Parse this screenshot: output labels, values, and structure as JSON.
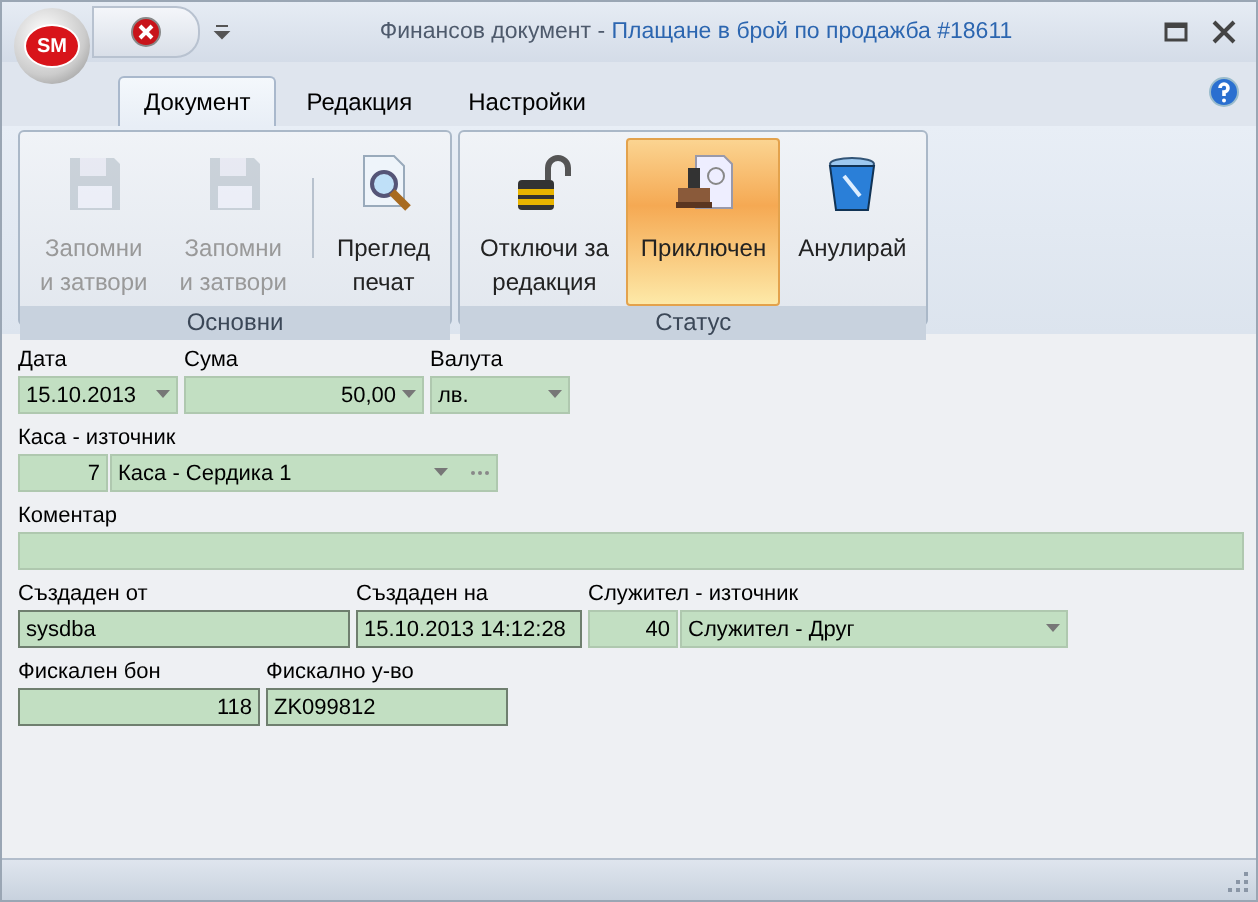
{
  "window": {
    "app_badge": "SM",
    "title_prefix": "Финансов документ - ",
    "title_main": "Плащане в брой по продажба #18611"
  },
  "tabs": [
    {
      "label": "Документ",
      "selected": true
    },
    {
      "label": "Редакция",
      "selected": false
    },
    {
      "label": "Настройки",
      "selected": false
    }
  ],
  "ribbon_groups": [
    {
      "label": "Основни",
      "buttons": [
        {
          "kind": "floppy",
          "label": "Запомни\nи затвори",
          "disabled": true,
          "selected": false,
          "separator_before": false
        },
        {
          "kind": "floppy",
          "label": "Запомни\nи затвори",
          "disabled": true,
          "selected": false,
          "separator_before": false
        },
        {
          "kind": "preview",
          "label": "Преглед\nпечат",
          "disabled": false,
          "selected": false,
          "separator_before": true
        }
      ]
    },
    {
      "label": "Статус",
      "buttons": [
        {
          "kind": "padlock",
          "label": "Отключи за\nредакция",
          "disabled": false,
          "selected": false,
          "separator_before": false
        },
        {
          "kind": "stamp",
          "label": "Приключен",
          "disabled": false,
          "selected": true,
          "separator_before": false
        },
        {
          "kind": "trash",
          "label": "Анулирай",
          "disabled": false,
          "selected": false,
          "separator_before": false
        }
      ]
    }
  ],
  "form_rows": [
    [
      {
        "label": "Дата",
        "parts": [
          {
            "kind": "text",
            "value": "15.10.2013",
            "dropdown": true,
            "ellipsis": false
          }
        ],
        "readonly": false
      },
      {
        "label": "Сума",
        "parts": [
          {
            "kind": "number",
            "value": "50,00",
            "dropdown": true,
            "ellipsis": false
          }
        ],
        "readonly": false
      },
      {
        "label": "Валута",
        "parts": [
          {
            "kind": "text",
            "value": "лв.",
            "dropdown": true,
            "ellipsis": false
          }
        ],
        "readonly": false
      }
    ],
    [
      {
        "label": "Каса - източник",
        "parts": [
          {
            "kind": "number",
            "value": "7",
            "dropdown": false,
            "ellipsis": false
          },
          {
            "kind": "text",
            "value": "Каса - Сердика 1",
            "dropdown": true,
            "ellipsis": true
          }
        ],
        "readonly": false
      }
    ],
    [
      {
        "label": "Коментар",
        "parts": [
          {
            "kind": "text",
            "dropdown": false,
            "ellipsis": false
          }
        ],
        "readonly": false
      }
    ],
    [
      {
        "label": "Създаден от",
        "parts": [
          {
            "kind": "text",
            "value": "sysdba",
            "dropdown": false,
            "ellipsis": false
          }
        ],
        "readonly": true
      },
      {
        "label": "Създаден на",
        "parts": [
          {
            "kind": "text",
            "value": "15.10.2013 14:12:28",
            "dropdown": false,
            "ellipsis": false
          }
        ],
        "readonly": true
      },
      {
        "label": "Служител - източник",
        "parts": [
          {
            "kind": "number",
            "value": "40",
            "dropdown": false,
            "ellipsis": false
          },
          {
            "kind": "text",
            "value": "Служител - Друг",
            "dropdown": true,
            "ellipsis": false
          }
        ],
        "readonly": false
      }
    ],
    [
      {
        "label": "Фискален бон",
        "parts": [
          {
            "kind": "number",
            "value": "118",
            "dropdown": false,
            "ellipsis": false
          }
        ],
        "readonly": true
      },
      {
        "label": "Фискално у-во",
        "parts": [
          {
            "kind": "text",
            "value": "ZK099812",
            "dropdown": false,
            "ellipsis": false
          }
        ],
        "readonly": true
      }
    ]
  ]
}
